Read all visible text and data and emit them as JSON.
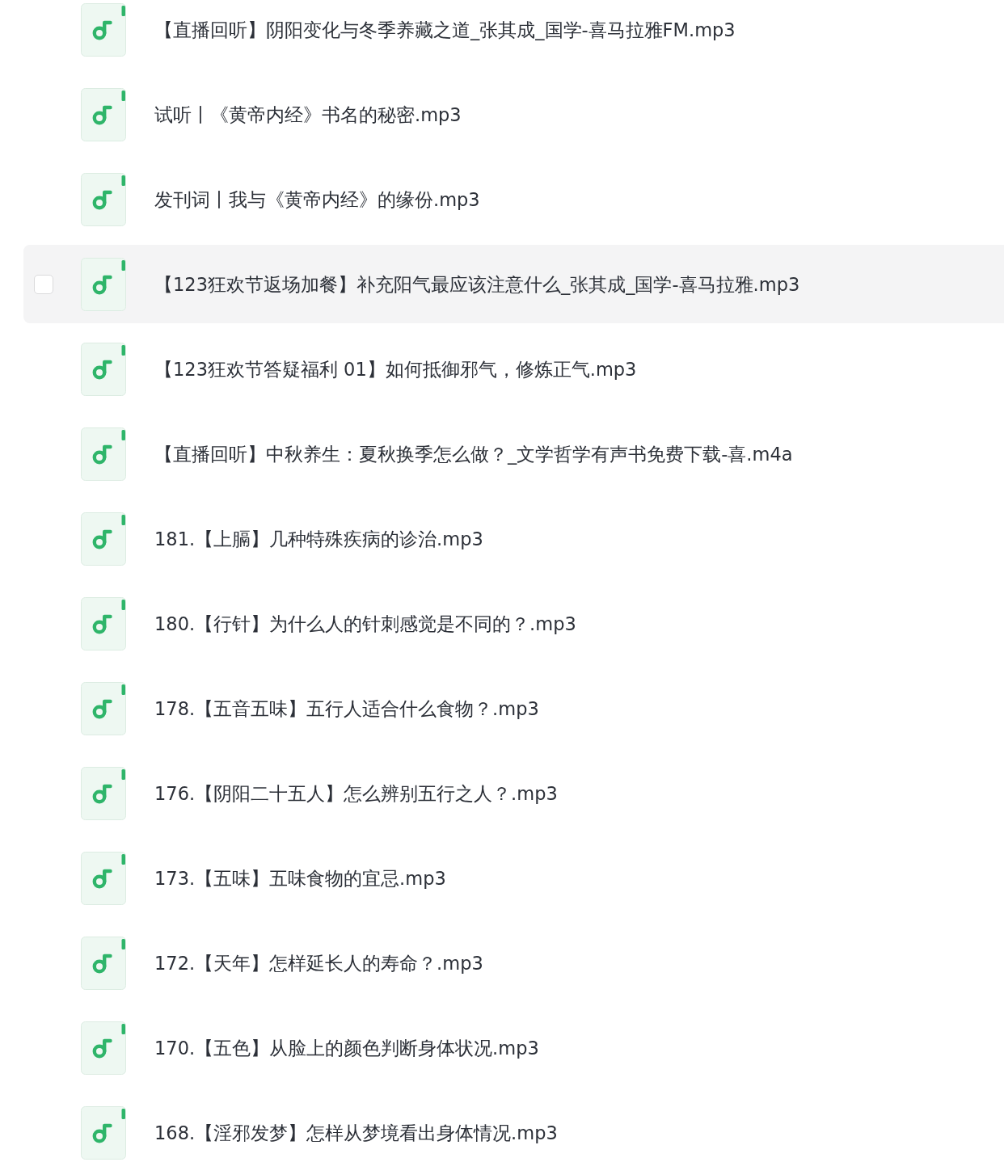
{
  "files": [
    {
      "name": "【直播回听】阴阳变化与冬季养藏之道_张其成_国学-喜马拉雅FM.mp3",
      "hovered": false,
      "checked": false
    },
    {
      "name": "试听丨《黄帝内经》书名的秘密.mp3",
      "hovered": false,
      "checked": false
    },
    {
      "name": "发刊词丨我与《黄帝内经》的缘份.mp3",
      "hovered": false,
      "checked": false
    },
    {
      "name": "【123狂欢节返场加餐】补充阳气最应该注意什么_张其成_国学-喜马拉雅.mp3",
      "hovered": true,
      "checked": false
    },
    {
      "name": "【123狂欢节答疑福利 01】如何抵御邪气，修炼正气.mp3",
      "hovered": false,
      "checked": false
    },
    {
      "name": "【直播回听】中秋养生：夏秋换季怎么做？_文学哲学有声书免费下载-喜.m4a",
      "hovered": false,
      "checked": false
    },
    {
      "name": "181.【上膈】几种特殊疾病的诊治.mp3",
      "hovered": false,
      "checked": false
    },
    {
      "name": "180.【行针】为什么人的针刺感觉是不同的？.mp3",
      "hovered": false,
      "checked": false
    },
    {
      "name": "178.【五音五味】五行人适合什么食物？.mp3",
      "hovered": false,
      "checked": false
    },
    {
      "name": "176.【阴阳二十五人】怎么辨别五行之人？.mp3",
      "hovered": false,
      "checked": false
    },
    {
      "name": "173.【五味】五味食物的宜忌.mp3",
      "hovered": false,
      "checked": false
    },
    {
      "name": "172.【天年】怎样延长人的寿命？.mp3",
      "hovered": false,
      "checked": false
    },
    {
      "name": "170.【五色】从脸上的颜色判断身体状况.mp3",
      "hovered": false,
      "checked": false
    },
    {
      "name": "168.【淫邪发梦】怎样从梦境看出身体情况.mp3",
      "hovered": false,
      "checked": false
    }
  ]
}
